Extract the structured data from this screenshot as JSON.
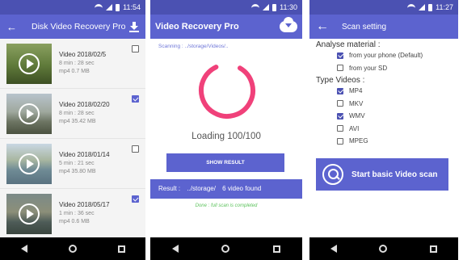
{
  "screens": [
    {
      "status_time": "11:54",
      "title": "Disk Video Recovery Pro",
      "videos": [
        {
          "name": "Video 2018/02/5",
          "duration": "8 min : 28 sec",
          "size": "mp4 0.7 MB",
          "checked": false
        },
        {
          "name": "Video 2018/02/20",
          "duration": "8 min : 28 sec",
          "size": "mp4 35.42 MB",
          "checked": true
        },
        {
          "name": "Video 2018/01/14",
          "duration": "5 min : 21 sec",
          "size": "mp4 35.80 MB",
          "checked": false
        },
        {
          "name": "Video 2018/05/17",
          "duration": "1 min : 36 sec",
          "size": "mp4 0.6 MB",
          "checked": true
        }
      ]
    },
    {
      "status_time": "11:30",
      "title": "Video Recovery Pro",
      "scanning_text": "Scanning :  ../storage/Videos/..",
      "loading_text": "Loading 100/100",
      "show_result_label": "SHOW RESULT",
      "result_label": "Result :",
      "result_path": "../storage/",
      "result_count": "6 video found",
      "done_text": "Done : full scan is completed",
      "progress_percent": 100
    },
    {
      "status_time": "11:27",
      "title": "Scan setting",
      "analyse_label": "Analyse material :",
      "analyse_options": [
        {
          "label": "from your phone (Default)",
          "checked": true
        },
        {
          "label": "from your SD",
          "checked": false
        }
      ],
      "type_label": "Type Videos :",
      "type_options": [
        {
          "label": "MP4",
          "checked": true
        },
        {
          "label": "MKV",
          "checked": false
        },
        {
          "label": "WMV",
          "checked": true
        },
        {
          "label": "AVI",
          "checked": false
        },
        {
          "label": "MPEG",
          "checked": false
        }
      ],
      "scan_button_label": "Start basic Video scan"
    }
  ],
  "colors": {
    "status_bar": "#4b51b2",
    "app_bar": "#5c63cf",
    "spinner": "#f0417a",
    "done_text": "#5dc35d"
  },
  "icons": [
    "back-arrow-icon",
    "download-icon",
    "play-icon",
    "cloud-download-icon",
    "scan-settings-icon",
    "nav-back-icon",
    "nav-home-icon",
    "nav-recents-icon"
  ]
}
